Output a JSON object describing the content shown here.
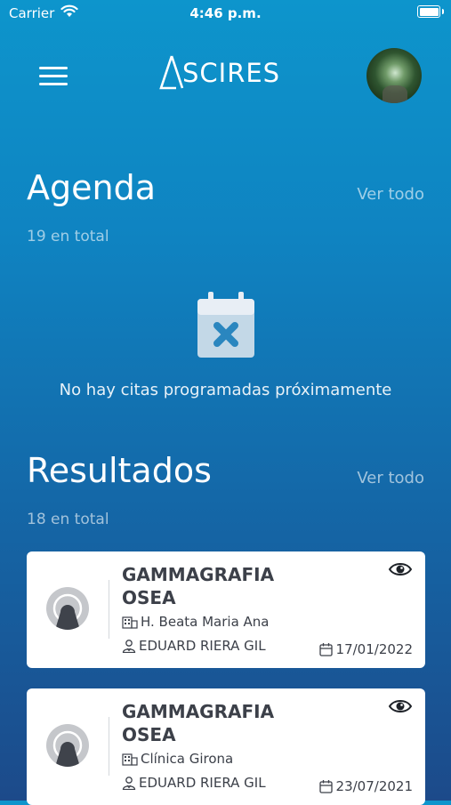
{
  "status_bar": {
    "carrier": "Carrier",
    "time": "4:46 p.m."
  },
  "header": {
    "logo_text": "SCIRES"
  },
  "agenda": {
    "title": "Agenda",
    "view_all": "Ver todo",
    "count": "19 en total",
    "empty_message": "No hay citas programadas próximamente"
  },
  "results": {
    "title": "Resultados",
    "view_all": "Ver todo",
    "count": "18 en total",
    "items": [
      {
        "title_line1": "GAMMAGRAFIA",
        "title_line2": "OSEA",
        "center": "H. Beata Maria Ana",
        "doctor": "EDUARD RIERA GIL",
        "date": "17/01/2022"
      },
      {
        "title_line1": "GAMMAGRAFIA",
        "title_line2": "OSEA",
        "center": "Clínica Girona",
        "doctor": "EDUARD RIERA GIL",
        "date": "23/07/2021"
      }
    ]
  },
  "colors": {
    "accent": "#0f83c1",
    "card_text": "#3c4049"
  }
}
